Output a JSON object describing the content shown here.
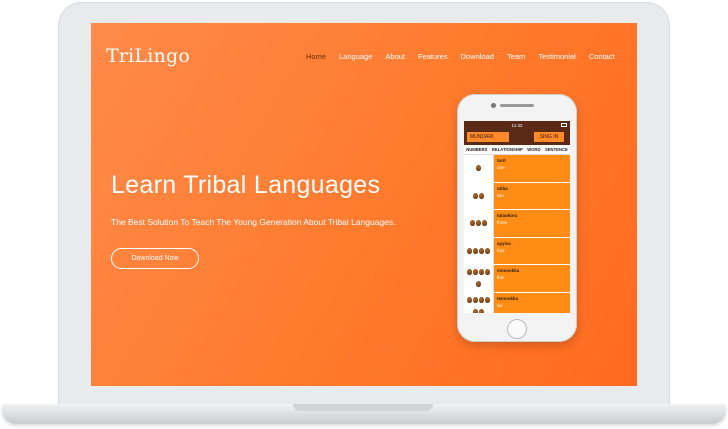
{
  "site": {
    "logo": "TriLingo",
    "nav": [
      "Home",
      "Language",
      "About",
      "Features",
      "Download",
      "Team",
      "Testimonial",
      "Contact"
    ],
    "active_nav": "Home"
  },
  "hero": {
    "title": "Learn Tribal Languages",
    "subtitle": "The Best Solution To Teach The Young Generation About Tribal Languages.",
    "cta": "Download Now"
  },
  "phone_app": {
    "time": "11:42",
    "language": "MUNDARI",
    "signin": "SING IN",
    "tabs": [
      "NUMBERS",
      "RELATIONSHIP",
      "WORD",
      "SENTENCE"
    ],
    "items": [
      {
        "word": "turit",
        "meaning": "one"
      },
      {
        "word": "utiba",
        "meaning": "two"
      },
      {
        "word": "tulaokoru",
        "meaning": "three"
      },
      {
        "word": "ayyiva",
        "meaning": "four"
      },
      {
        "word": "moosokka",
        "meaning": "five"
      },
      {
        "word": "temnokka",
        "meaning": "six"
      }
    ]
  },
  "colors": {
    "hero_bg": "#ff7a2c",
    "app_header": "#5a2a16",
    "app_accent": "#ff8c14"
  }
}
